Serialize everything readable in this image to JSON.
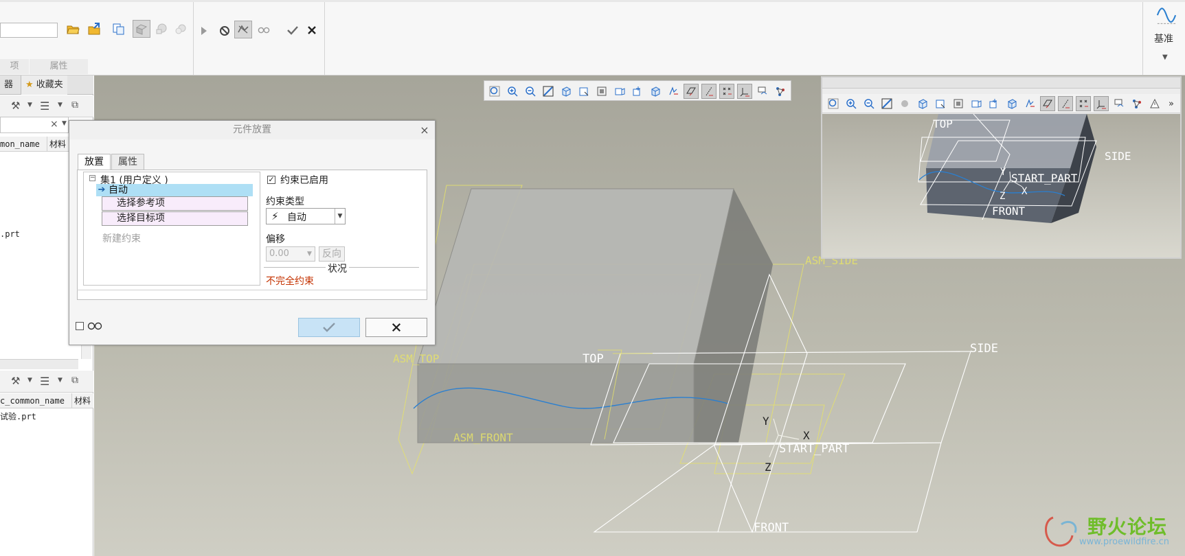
{
  "ribbon": {
    "tabs": [
      "项",
      "属性"
    ],
    "datum_group_label": "基准"
  },
  "navigator": {
    "tabs": [
      "器",
      "收藏夹"
    ],
    "model_tree": {
      "column_headers": [
        "mon_name",
        "材料"
      ],
      "rows": [
        ".prt"
      ]
    },
    "layer_tree": {
      "column_headers": [
        "c_common_name",
        "材料"
      ],
      "rows": [
        "试验.prt"
      ]
    }
  },
  "graphics": {
    "labels": {
      "top": "TOP",
      "start_part": "START_PART",
      "side": "SIDE",
      "front": "FRONT",
      "y": "Y",
      "x": "X",
      "z": "Z",
      "asm_top": "ASM_TOP",
      "asm_front": "ASM_FRONT",
      "asm_side": "ASM_SIDE"
    }
  },
  "mini_window": {
    "labels": {
      "top": "TOP",
      "side": "SIDE",
      "start_part": "START_PART",
      "front": "FRONT",
      "y": "Y",
      "x": "X",
      "z": "Z"
    }
  },
  "dialog": {
    "title": "元件放置",
    "tabs": [
      "放置",
      "属性"
    ],
    "tree": {
      "set_label": "集1 (用户定义 )",
      "auto_label": "自动",
      "reference_label": "选择参考项",
      "target_label": "选择目标项",
      "new_constraint_label": "新建约束"
    },
    "constraint_enabled_label": "约束已启用",
    "constraint_type_label": "约束类型",
    "constraint_type_value": "自动",
    "offset_label": "偏移",
    "offset_value": "0.00",
    "flip_label": "反向",
    "status_label": "状况",
    "status_value": "不完全约束",
    "status_color": "#c43200"
  },
  "watermark": {
    "title": "野火论坛",
    "url": "www.proewildfire.cn"
  },
  "colors": {
    "accent": "#aedff5",
    "datum_yellow": "#e6e26a",
    "curve_blue": "#2a7fd0"
  }
}
